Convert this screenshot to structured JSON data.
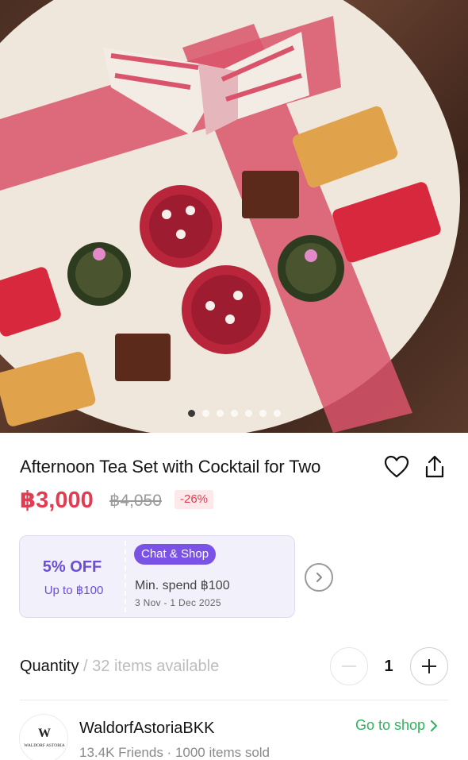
{
  "gallery": {
    "image_description_icon": "afternoon-tea-photo",
    "dot_count": 7,
    "active_index": 0
  },
  "product": {
    "title": "Afternoon Tea Set with Cocktail for Two",
    "price": "฿3,000",
    "original_price": "฿4,050",
    "discount": "-26%"
  },
  "coupon": {
    "percent": "5% OFF",
    "up_to": "Up to ฿100",
    "badge": "Chat & Shop",
    "min_spend": "Min. spend ฿100",
    "dates": "3 Nov - 1 Dec 2025"
  },
  "quantity": {
    "label": "Quantity",
    "available": " / 32 items available",
    "value": "1"
  },
  "shop": {
    "name": "WaldorfAstoriaBKK",
    "stats": "13.4K Friends · 1000 items sold",
    "goto": "Go to shop",
    "logo_text": "WALDORF ASTORIA"
  },
  "colors": {
    "price_red": "#e23c53",
    "coupon_purple": "#6b4dd6",
    "link_green": "#2fb35f"
  }
}
